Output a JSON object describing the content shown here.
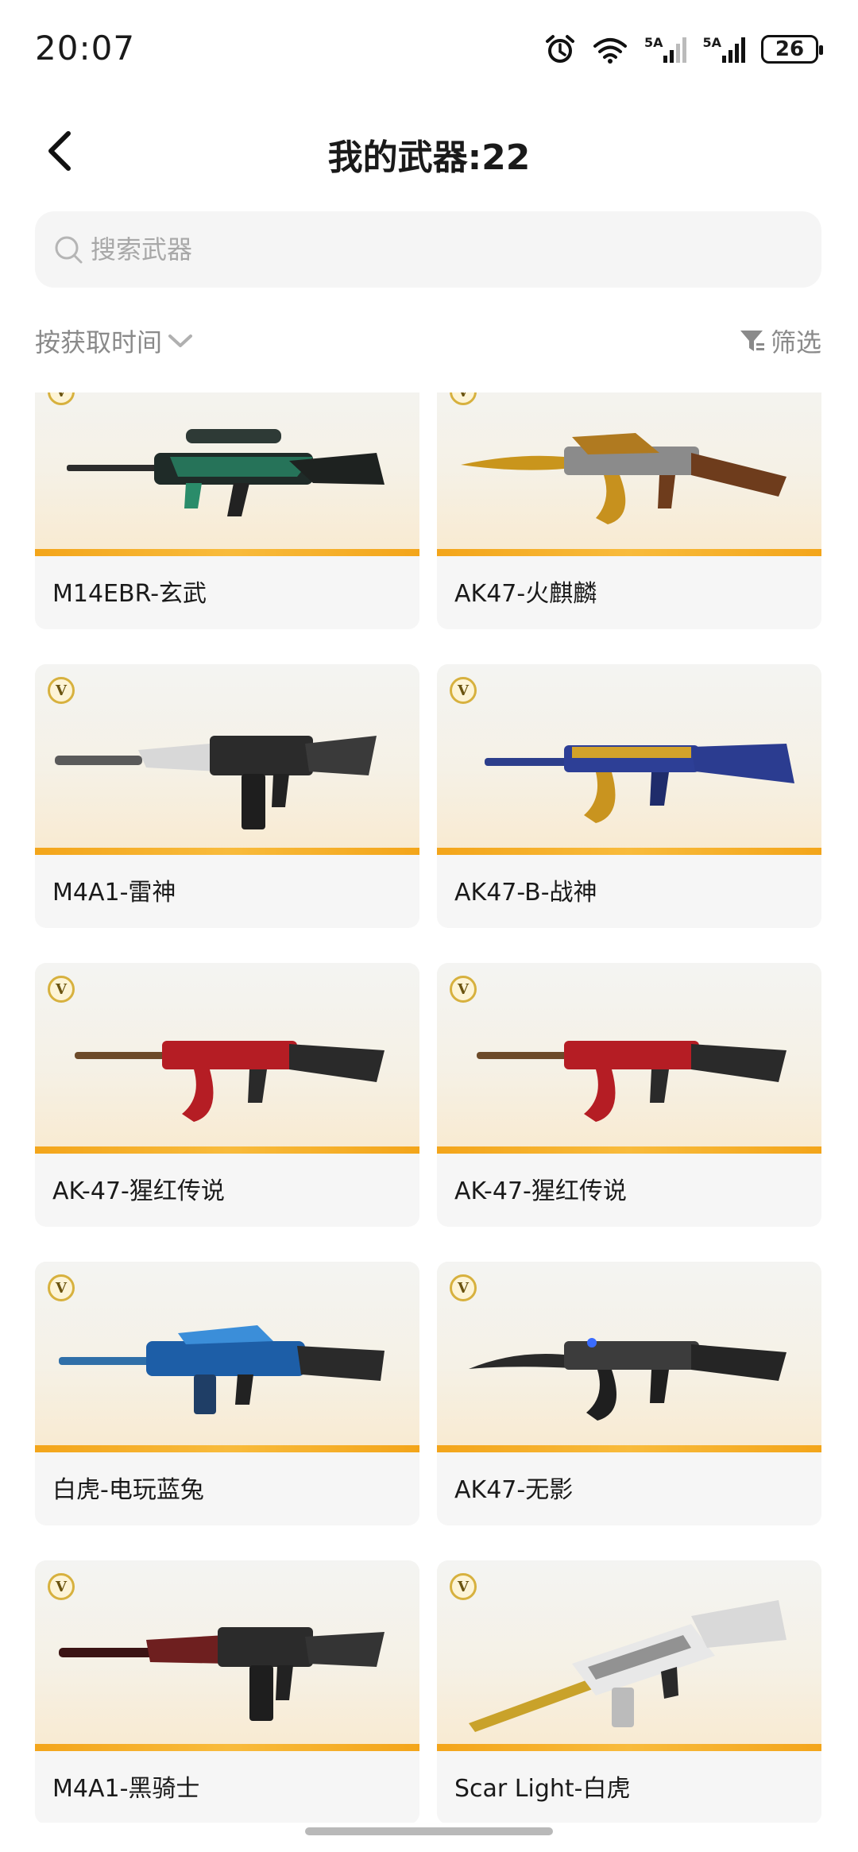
{
  "status_bar": {
    "time": "20:07",
    "signal1_label": "5A",
    "signal2_label": "5A",
    "battery": "26"
  },
  "header": {
    "title": "我的武器:22"
  },
  "search": {
    "placeholder": "搜索武器"
  },
  "sort": {
    "label": "按获取时间"
  },
  "filter": {
    "label": "筛选"
  },
  "colors": {
    "accent_bar": "#f3a51a",
    "card_bg": "#f6f6f6",
    "muted_text": "#8a8a8a"
  },
  "weapons": [
    {
      "name": "M14EBR-玄武",
      "icon": "sniper-rifle-green-image"
    },
    {
      "name": "AK47-火麒麟",
      "icon": "ak47-gold-dragon-image"
    },
    {
      "name": "M4A1-雷神",
      "icon": "m4a1-silver-image"
    },
    {
      "name": "AK47-B-战神",
      "icon": "ak47-blue-gold-image"
    },
    {
      "name": "AK-47-猩红传说",
      "icon": "ak47-red-image"
    },
    {
      "name": "AK-47-猩红传说",
      "icon": "ak47-red-image"
    },
    {
      "name": "白虎-电玩蓝兔",
      "icon": "rifle-blue-image"
    },
    {
      "name": "AK47-无影",
      "icon": "ak47-black-blade-image"
    },
    {
      "name": "M4A1-黑骑士",
      "icon": "m4a1-dark-red-image"
    },
    {
      "name": "Scar Light-白虎",
      "icon": "scar-white-gold-image"
    }
  ]
}
